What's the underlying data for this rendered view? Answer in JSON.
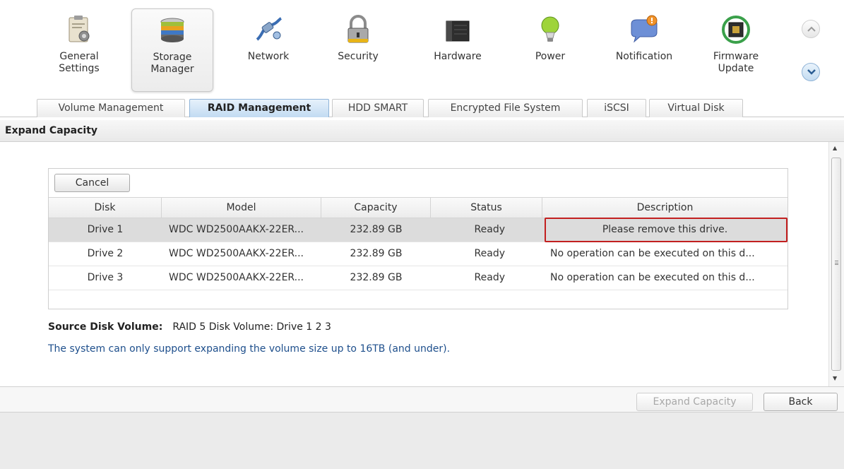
{
  "toolbar": {
    "items": [
      {
        "label": "General\nSettings",
        "icon": "clipboard-gear-icon"
      },
      {
        "label": "Storage\nManager",
        "icon": "disk-stack-icon",
        "active": true
      },
      {
        "label": "Network",
        "icon": "network-plug-icon"
      },
      {
        "label": "Security",
        "icon": "padlock-icon"
      },
      {
        "label": "Hardware",
        "icon": "nas-box-icon"
      },
      {
        "label": "Power",
        "icon": "lightbulb-icon"
      },
      {
        "label": "Notification",
        "icon": "speech-bubble-alert-icon"
      },
      {
        "label": "Firmware\nUpdate",
        "icon": "chip-refresh-icon"
      }
    ]
  },
  "tabs": [
    {
      "label": "Volume Management"
    },
    {
      "label": "RAID Management",
      "active": true
    },
    {
      "label": "HDD SMART"
    },
    {
      "label": "Encrypted File System"
    },
    {
      "label": "iSCSI"
    },
    {
      "label": "Virtual Disk"
    }
  ],
  "section": {
    "title": "Expand Capacity"
  },
  "panel": {
    "cancel_label": "Cancel",
    "columns": [
      "Disk",
      "Model",
      "Capacity",
      "Status",
      "Description"
    ],
    "rows": [
      {
        "disk": "Drive 1",
        "model": "WDC WD2500AAKX-22ER...",
        "capacity": "232.89 GB",
        "status": "Ready",
        "description": "Please remove this drive.",
        "selected": true
      },
      {
        "disk": "Drive 2",
        "model": "WDC WD2500AAKX-22ER...",
        "capacity": "232.89 GB",
        "status": "Ready",
        "description": "No operation can be executed on this d..."
      },
      {
        "disk": "Drive 3",
        "model": "WDC WD2500AAKX-22ER...",
        "capacity": "232.89 GB",
        "status": "Ready",
        "description": "No operation can be executed on this d..."
      }
    ]
  },
  "source": {
    "label": "Source Disk Volume:",
    "value": "RAID 5 Disk Volume: Drive 1 2 3"
  },
  "note": "The system can only support expanding the volume size up to 16TB (and under).",
  "footer": {
    "expand_label": "Expand Capacity",
    "back_label": "Back"
  },
  "colors": {
    "accent": "#c2dbf2",
    "highlight_border": "#c21f1f",
    "note_text": "#1e4f8c"
  }
}
